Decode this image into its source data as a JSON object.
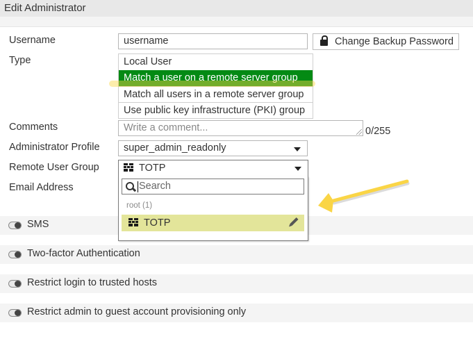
{
  "window": {
    "title": "Edit Administrator"
  },
  "form": {
    "username": {
      "label": "Username",
      "value": "username"
    },
    "change_backup_password": {
      "label": "Change Backup Password",
      "icon": "lock-icon"
    },
    "type": {
      "label": "Type",
      "options": [
        "Local User",
        "Match a user on a remote server group",
        "Match all users in a remote server group",
        "Use public key infrastructure (PKI) group"
      ],
      "selected": "Match a user on a remote server group"
    },
    "comments": {
      "label": "Comments",
      "placeholder": "Write a comment...",
      "counter": "0/255"
    },
    "admin_profile": {
      "label": "Administrator Profile",
      "value": "super_admin_readonly"
    },
    "remote_user_group": {
      "label": "Remote User Group",
      "value": "TOTP",
      "icon": "user-group-icon",
      "dropdown": {
        "search_placeholder": "Search",
        "group_header": "root (1)",
        "items": [
          {
            "label": "TOTP",
            "icon": "user-group-icon",
            "action_icon": "pencil-icon"
          }
        ]
      }
    },
    "email": {
      "label": "Email Address"
    }
  },
  "sections": [
    {
      "label": "SMS",
      "enabled": false
    },
    {
      "label": "Two-factor Authentication",
      "enabled": false
    },
    {
      "label": "Restrict login to trusted hosts",
      "enabled": false
    },
    {
      "label": "Restrict admin to guest account provisioning only",
      "enabled": false
    }
  ],
  "annotation": {
    "arrow_color": "#fad546",
    "highlight_color": "#fad546"
  },
  "colors": {
    "selected_option": "#048a14",
    "dropdown_item_highlight": "#e3e59a"
  }
}
